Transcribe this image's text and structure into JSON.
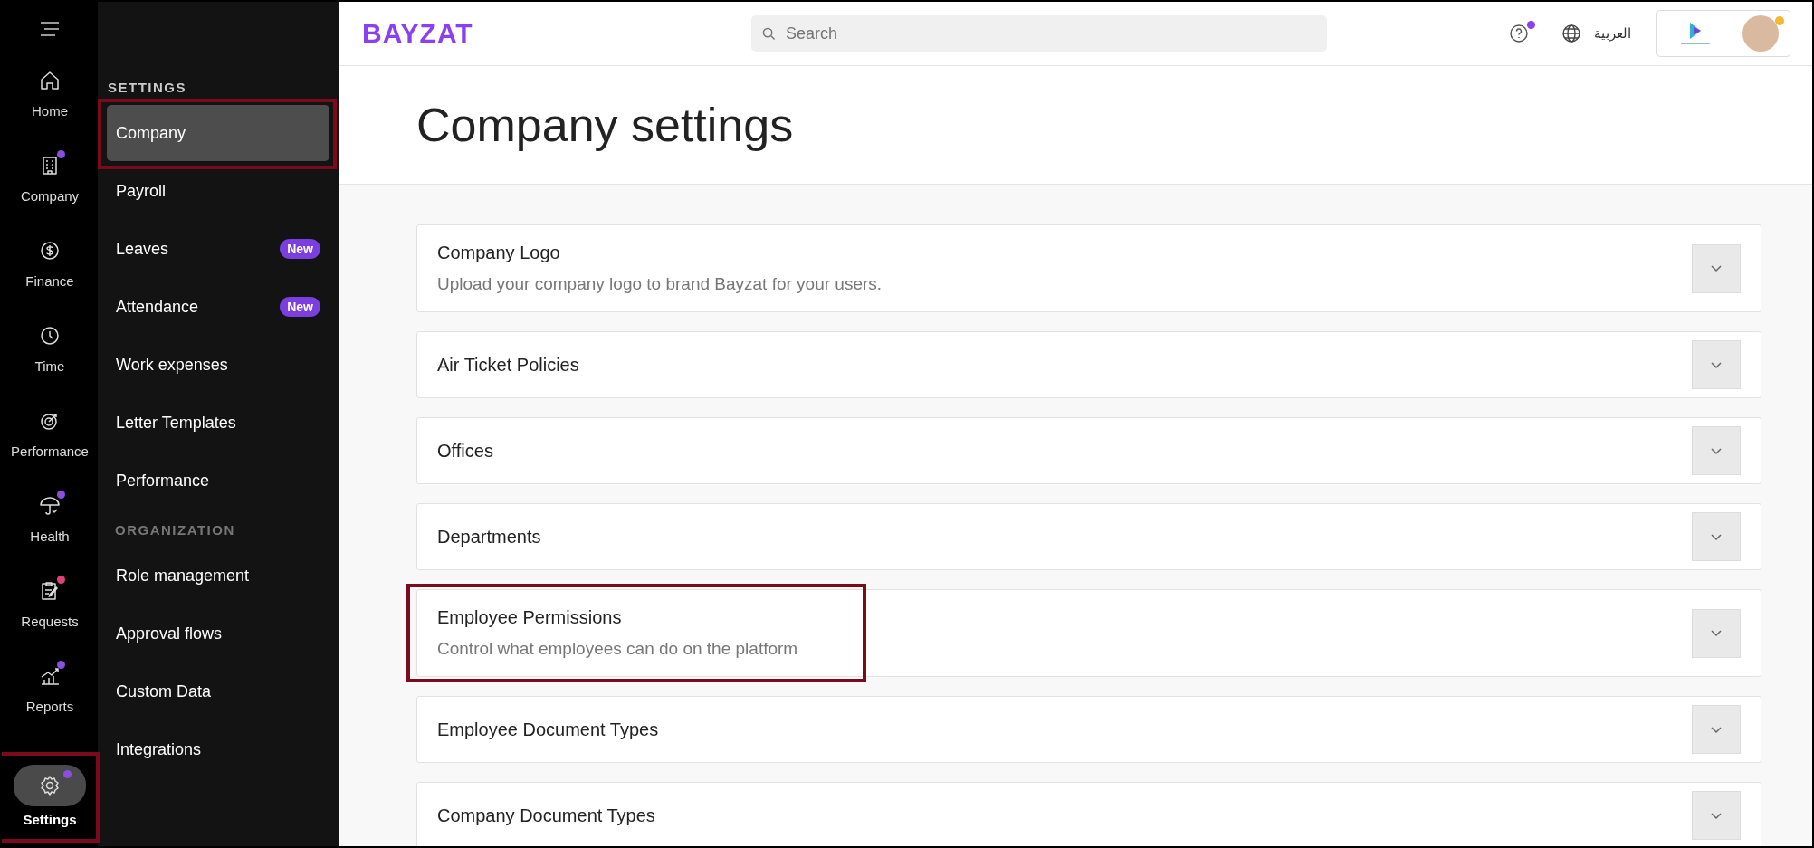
{
  "rail": {
    "items": [
      {
        "label": "Home",
        "selected": false,
        "highlighted": false
      },
      {
        "label": "Company",
        "selected": false,
        "highlighted": false,
        "color": "#8a4fe0"
      },
      {
        "label": "Finance",
        "selected": false,
        "highlighted": false
      },
      {
        "label": "Time",
        "selected": false,
        "highlighted": false
      },
      {
        "label": "Performance",
        "selected": false,
        "highlighted": false
      },
      {
        "label": "Health",
        "selected": false,
        "highlighted": false,
        "color": "#8a4fe0"
      },
      {
        "label": "Requests",
        "selected": false,
        "highlighted": false,
        "color": "#e0407a"
      },
      {
        "label": "Reports",
        "selected": false,
        "highlighted": false,
        "color": "#8a4fe0"
      },
      {
        "label": "Settings",
        "selected": true,
        "highlighted": true,
        "color": "#8a4fe0"
      }
    ]
  },
  "settings_nav": {
    "groups": [
      {
        "heading": "SETTINGS",
        "items": [
          {
            "label": "Company",
            "selected": true,
            "highlighted": true
          },
          {
            "label": "Payroll",
            "selected": false,
            "highlighted": false
          },
          {
            "label": "Leaves",
            "selected": false,
            "highlighted": false,
            "badge": "New"
          },
          {
            "label": "Attendance",
            "selected": false,
            "highlighted": false,
            "badge": "New"
          },
          {
            "label": "Work expenses",
            "selected": false,
            "highlighted": false
          },
          {
            "label": "Letter Templates",
            "selected": false,
            "highlighted": false
          },
          {
            "label": "Performance",
            "selected": false,
            "highlighted": false
          }
        ]
      },
      {
        "heading": "ORGANIZATION",
        "items": [
          {
            "label": "Role management",
            "selected": false,
            "highlighted": false
          },
          {
            "label": "Approval flows",
            "selected": false,
            "highlighted": false
          },
          {
            "label": "Custom Data",
            "selected": false,
            "highlighted": false
          },
          {
            "label": "Integrations",
            "selected": false,
            "highlighted": false
          }
        ]
      }
    ]
  },
  "topbar": {
    "logo": "BAYZAT",
    "search": {
      "placeholder": "Search"
    },
    "help_notification": true,
    "language": "العربية",
    "profile_notification": true
  },
  "page_title": "Company settings",
  "sections": [
    {
      "title": "Company Logo",
      "description": "Upload your company logo to brand Bayzat for your users.",
      "expanded": false,
      "highlighted": false
    },
    {
      "title": "Air Ticket Policies",
      "expanded": false,
      "highlighted": false
    },
    {
      "title": "Offices",
      "expanded": false,
      "highlighted": false
    },
    {
      "title": "Departments",
      "expanded": false,
      "highlighted": false
    },
    {
      "title": "Employee Permissions",
      "description": "Control what employees can do on the platform",
      "expanded": false,
      "highlighted": true
    },
    {
      "title": "Employee Document Types",
      "expanded": false,
      "highlighted": false
    },
    {
      "title": "Company Document Types",
      "expanded": false,
      "highlighted": false
    }
  ]
}
